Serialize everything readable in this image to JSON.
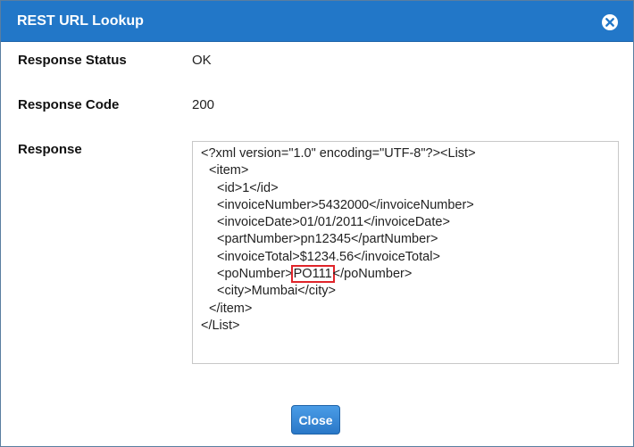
{
  "dialog": {
    "title": "REST URL Lookup",
    "close_icon": "close-circle-icon"
  },
  "fields": {
    "status_label": "Response Status",
    "status_value": "OK",
    "code_label": "Response Code",
    "code_value": "200",
    "response_label": "Response"
  },
  "response_lines": [
    {
      "indent": 0,
      "text": "<?xml version=\"1.0\" encoding=\"UTF-8\"?><List>"
    },
    {
      "indent": 1,
      "text": "<item>"
    },
    {
      "indent": 2,
      "text": "<id>1</id>"
    },
    {
      "indent": 2,
      "text": "<invoiceNumber>5432000</invoiceNumber>"
    },
    {
      "indent": 2,
      "text": "<invoiceDate>01/01/2011</invoiceDate>"
    },
    {
      "indent": 2,
      "text": "<partNumber>pn12345</partNumber>"
    },
    {
      "indent": 2,
      "text": "<invoiceTotal>$1234.56</invoiceTotal>"
    },
    {
      "indent": 2,
      "text_before": "<poNumber>",
      "highlight": "PO111",
      "text_after": "</poNumber>"
    },
    {
      "indent": 2,
      "text": "<city>Mumbai</city>"
    },
    {
      "indent": 1,
      "text": "</item>"
    },
    {
      "indent": 0,
      "text": "</List>"
    }
  ],
  "buttons": {
    "close_label": "Close"
  },
  "colors": {
    "titlebar": "#2277c8",
    "highlight_border": "#e0242a",
    "button": "#3a8ad6"
  }
}
